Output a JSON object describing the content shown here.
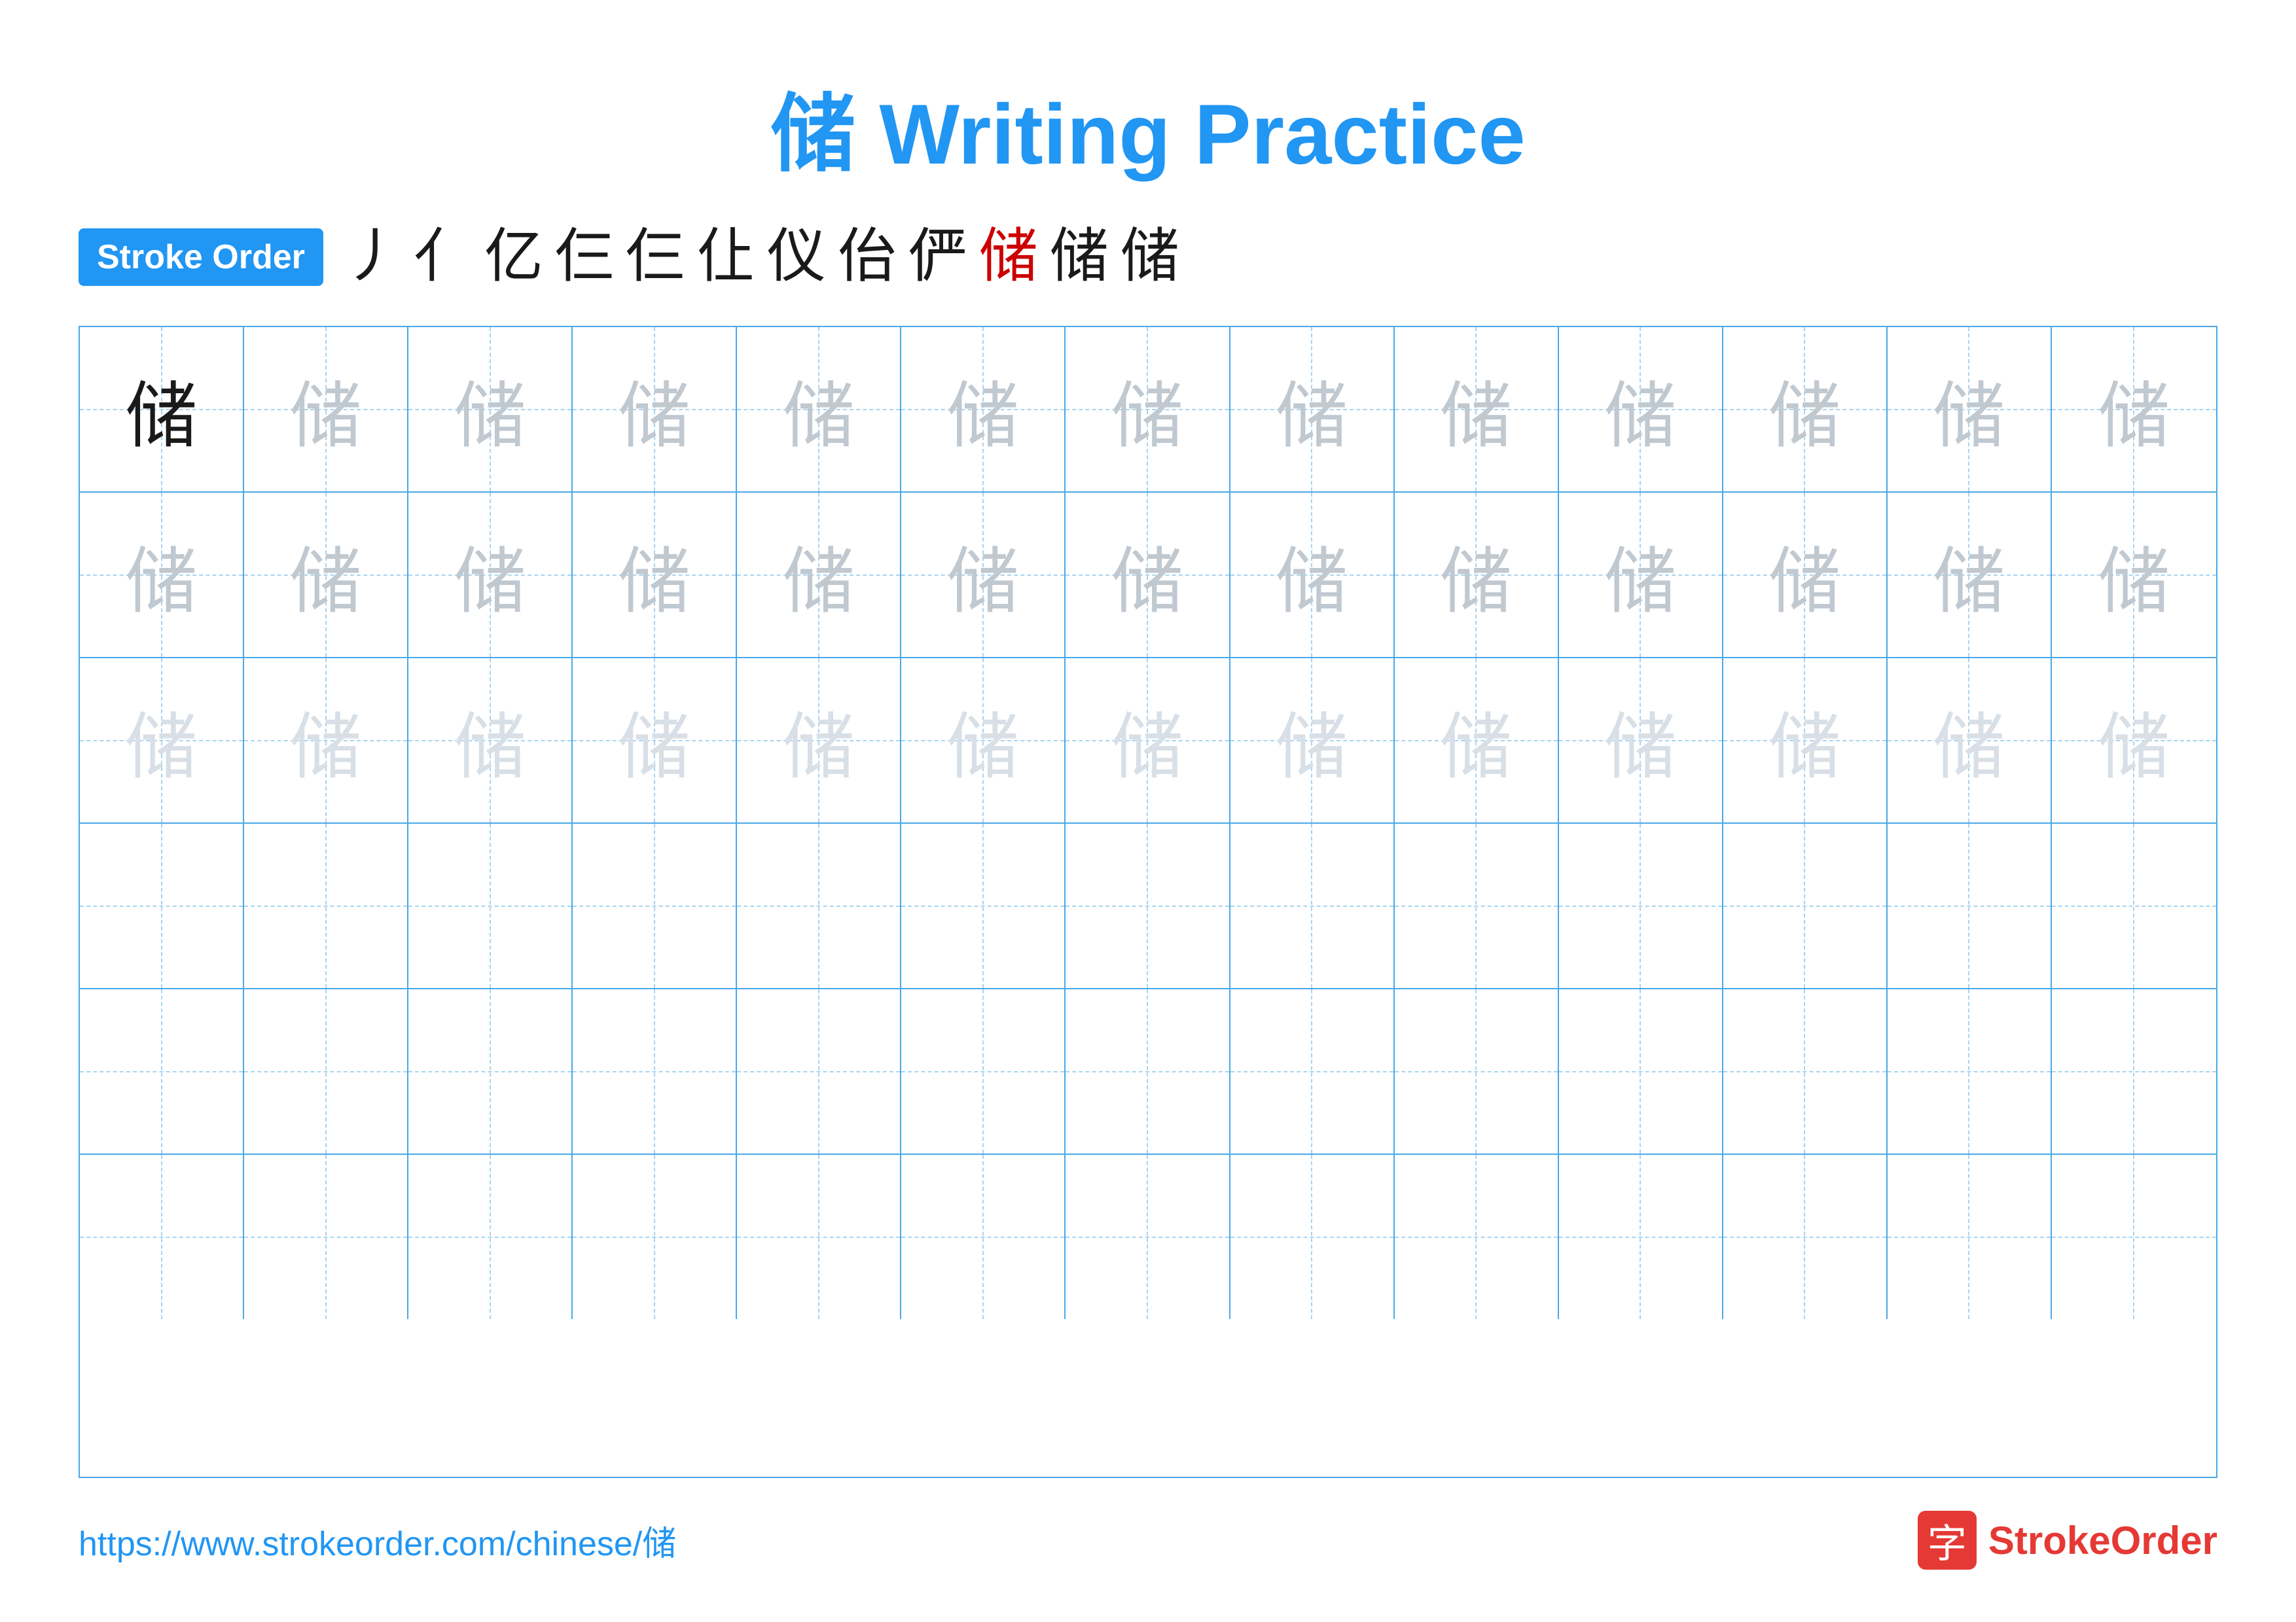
{
  "page": {
    "title": "储 Writing Practice",
    "stroke_order_label": "Stroke Order",
    "character": "储",
    "url": "https://www.strokeorder.com/chinese/储",
    "logo_char": "字",
    "logo_text_part1": "Stroke",
    "logo_text_part2": "Order"
  },
  "stroke_sequence": [
    "丿",
    "亻",
    "亿",
    "仨",
    "仨",
    "仩",
    "仪",
    "佁",
    "俨",
    "储",
    "储",
    "储"
  ],
  "rows": [
    {
      "style": "dark_first",
      "chars": [
        "储",
        "储",
        "储",
        "储",
        "储",
        "储",
        "储",
        "储",
        "储",
        "储",
        "储",
        "储",
        "储"
      ]
    },
    {
      "style": "medium",
      "chars": [
        "储",
        "储",
        "储",
        "储",
        "储",
        "储",
        "储",
        "储",
        "储",
        "储",
        "储",
        "储",
        "储"
      ]
    },
    {
      "style": "light",
      "chars": [
        "储",
        "储",
        "储",
        "储",
        "储",
        "储",
        "储",
        "储",
        "储",
        "储",
        "储",
        "储",
        "储"
      ]
    },
    {
      "style": "empty",
      "chars": [
        "",
        "",
        "",
        "",
        "",
        "",
        "",
        "",
        "",
        "",
        "",
        "",
        ""
      ]
    },
    {
      "style": "empty",
      "chars": [
        "",
        "",
        "",
        "",
        "",
        "",
        "",
        "",
        "",
        "",
        "",
        "",
        ""
      ]
    },
    {
      "style": "empty",
      "chars": [
        "",
        "",
        "",
        "",
        "",
        "",
        "",
        "",
        "",
        "",
        "",
        "",
        ""
      ]
    }
  ]
}
